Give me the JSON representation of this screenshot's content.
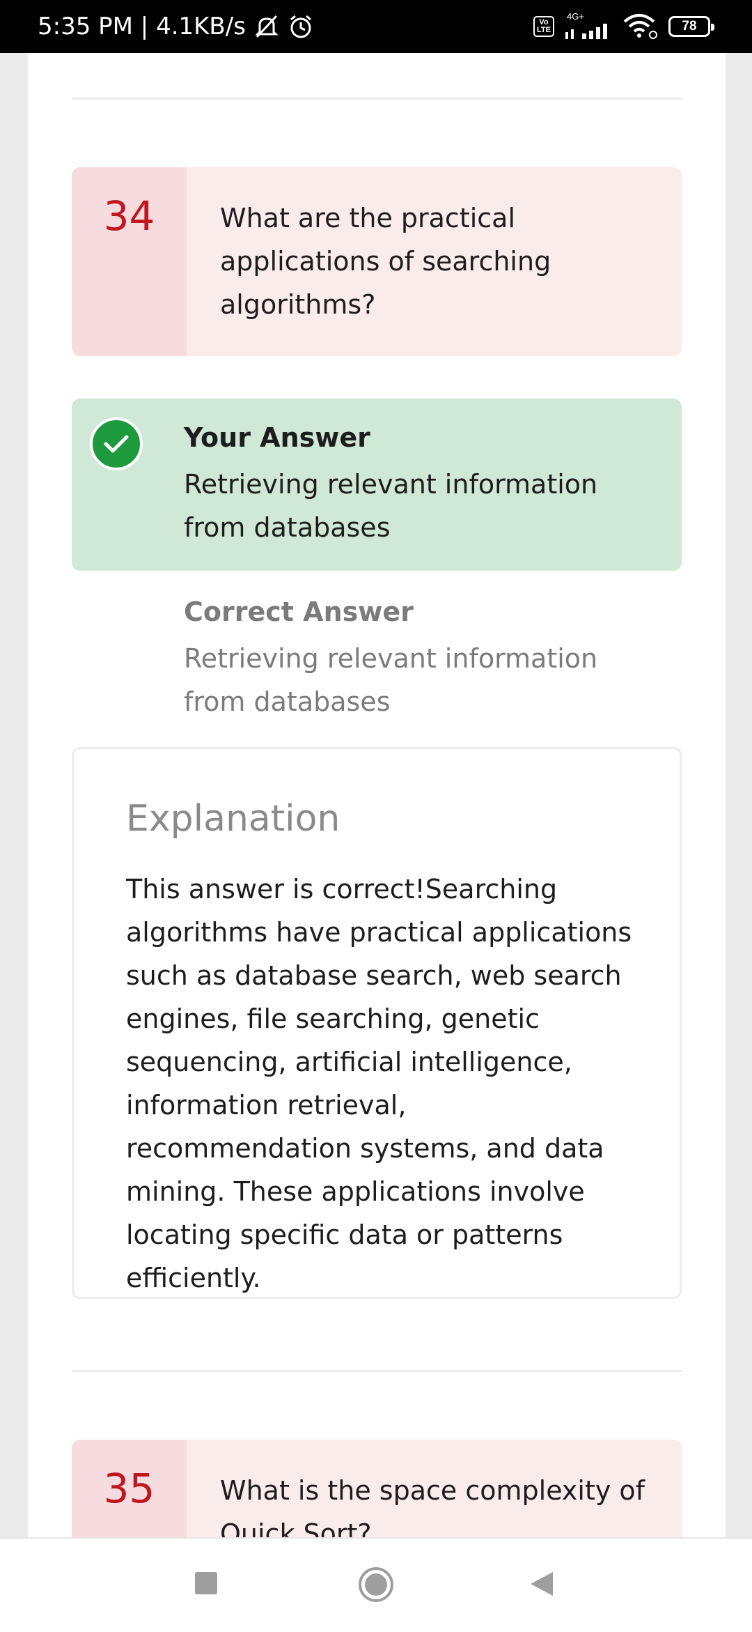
{
  "status_bar": {
    "time_speed": "5:35 PM | 4.1KB/s",
    "network_type": "4G+",
    "lte_badge": "Vo LTE",
    "battery": "78",
    "icons": [
      "mute-icon",
      "alarm-icon",
      "lte-icon",
      "signal-icon",
      "wifi-icon",
      "battery-icon"
    ]
  },
  "question_34": {
    "number": "34",
    "text": "What are the practical applications of searching algorithms?"
  },
  "your_answer": {
    "title": "Your Answer",
    "text": "Retrieving relevant information from databases",
    "status_icon": "check-circle-icon"
  },
  "correct_answer": {
    "title": "Correct Answer",
    "text": "Retrieving relevant information from databases"
  },
  "explanation": {
    "title": "Explanation",
    "text": "This answer is correct!Searching algorithms have practical applications such as database search, web search engines, file searching, genetic sequencing, artificial intelligence, information retrieval, recommendation systems, and data mining. These applications involve locating specific data or patterns efficiently."
  },
  "question_35": {
    "number": "35",
    "text": "What is the space complexity of Quick Sort?"
  },
  "nav_bar": {
    "icons": [
      "recents-square-icon",
      "home-circle-icon",
      "back-triangle-icon"
    ]
  },
  "colors": {
    "accent_red": "#c0161f",
    "question_bg": "#fbecec",
    "number_bg": "#f6dcdf",
    "answer_green_bg": "#cfe9d6",
    "check_green": "#1e9a3e"
  }
}
